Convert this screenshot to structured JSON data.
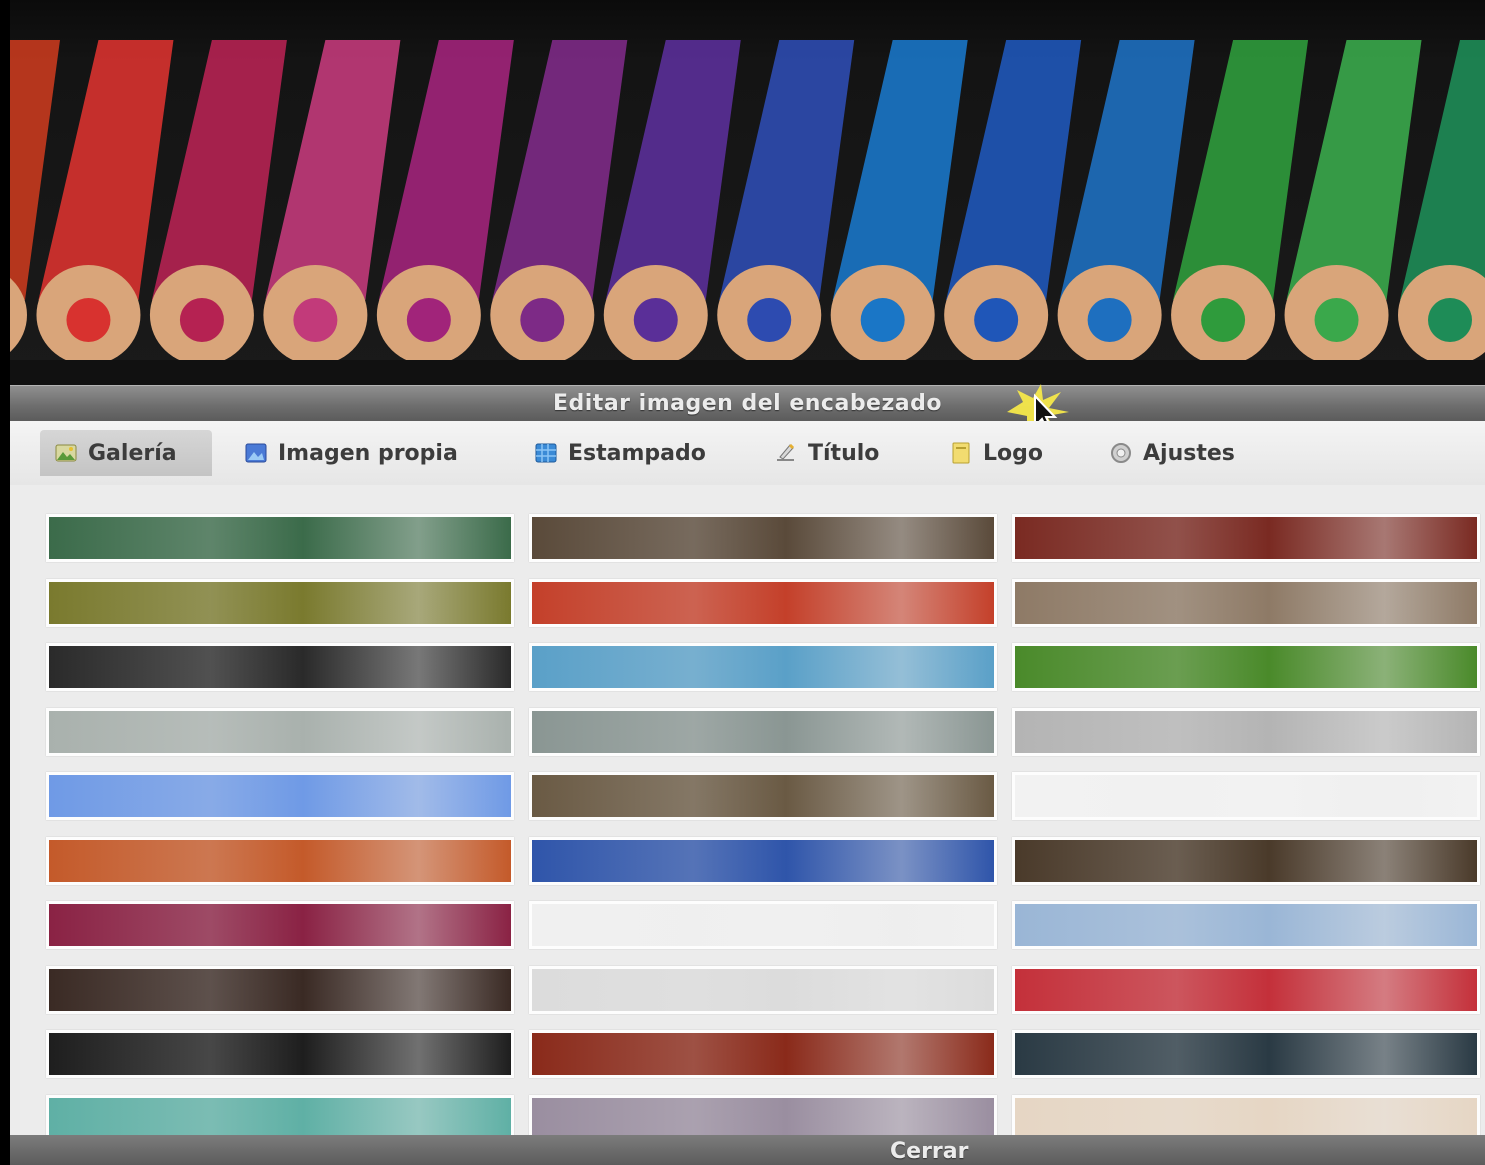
{
  "dialog": {
    "title": "Editar imagen del encabezado",
    "close_label": "Cerrar"
  },
  "tabs": [
    {
      "label": "Galería",
      "icon": "gallery-icon",
      "active": true
    },
    {
      "label": "Imagen propia",
      "icon": "image-icon",
      "active": false
    },
    {
      "label": "Estampado",
      "icon": "pattern-icon",
      "active": false
    },
    {
      "label": "Título",
      "icon": "text-icon",
      "active": false
    },
    {
      "label": "Logo",
      "icon": "logo-icon",
      "active": false
    },
    {
      "label": "Ajustes",
      "icon": "settings-icon",
      "active": false
    }
  ],
  "header_image": {
    "subject": "colored pencils",
    "pencil_colors": [
      "#c73a1e",
      "#d8322f",
      "#b52252",
      "#c23a7a",
      "#a1247a",
      "#7d2a86",
      "#5a2f98",
      "#2d4bb0",
      "#1a76c6",
      "#1f56b8",
      "#1e6fbf",
      "#2f9b3c",
      "#3aa84b",
      "#1e8c57",
      "#2ca05e"
    ]
  },
  "gallery": {
    "columns": [
      [
        "#3b6b4a",
        "#7a7a2e",
        "#2a2a2a",
        "#a9b1ad",
        "#6f9ae6",
        "#c45a2a",
        "#8a2244",
        "#3a2a24",
        "#1e1e1e",
        "#5fb0a5"
      ],
      [
        "#5a4a3a",
        "#c4402a",
        "#5aa0c8",
        "#8a9693",
        "#6a5a44",
        "#2f55aa",
        "#f0f0f0",
        "#dcdcdc",
        "#8a2a1a",
        "#9a8ea0"
      ],
      [
        "#7a2a22",
        "#8e7a66",
        "#4a8a2a",
        "#b4b4b4",
        "#f2f2f2",
        "#4a3a2a",
        "#9ab6d6",
        "#c4303a",
        "#2a3a44",
        "#e6d6c4"
      ]
    ]
  }
}
